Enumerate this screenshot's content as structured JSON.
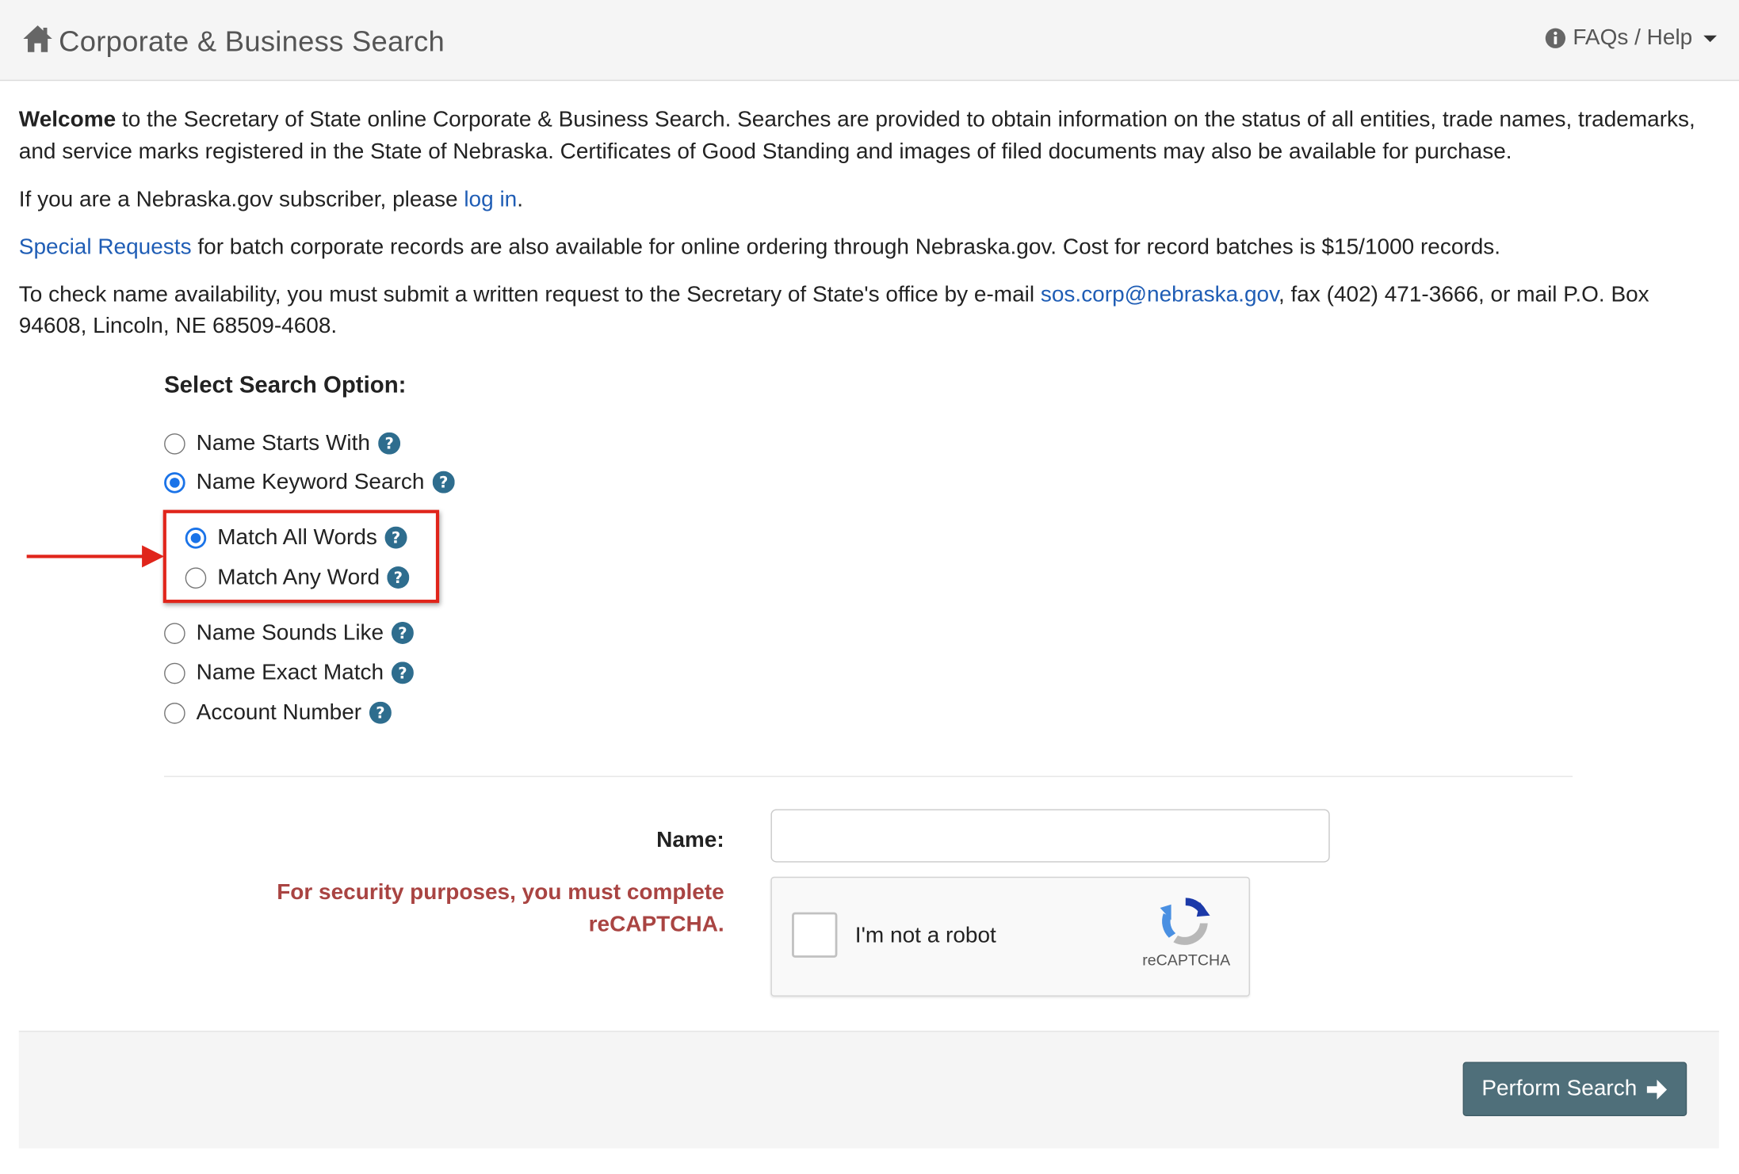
{
  "header": {
    "title": "Corporate & Business Search",
    "faq_label": "FAQs / Help"
  },
  "intro": {
    "p1_bold": "Welcome",
    "p1_rest": " to the Secretary of State online Corporate & Business Search. Searches are provided to obtain information on the status of all entities, trade names, trademarks, and service marks registered in the State of Nebraska. Certificates of Good Standing and images of filed documents may also be available for purchase.",
    "p2_pre": "If you are a Nebraska.gov subscriber, please ",
    "p2_link": "log in",
    "p2_post": ".",
    "p3_link": "Special Requests",
    "p3_rest": " for batch corporate records are also available for online ordering through Nebraska.gov. Cost for record batches is $15/1000 records.",
    "p4_pre": "To check name availability, you must submit a written request to the Secretary of State's office by e-mail ",
    "p4_link": "sos.corp@nebraska.gov",
    "p4_post": ", fax (402) 471-3666, or mail P.O. Box 94608, Lincoln, NE 68509-4608."
  },
  "search_options": {
    "heading": "Select Search Option:",
    "options": [
      {
        "label": "Name Starts With",
        "checked": false
      },
      {
        "label": "Name Keyword Search",
        "checked": true
      },
      {
        "label": "Match All Words",
        "checked": true
      },
      {
        "label": "Match Any Word",
        "checked": false
      },
      {
        "label": "Name Sounds Like",
        "checked": false
      },
      {
        "label": "Name Exact Match",
        "checked": false
      },
      {
        "label": "Account Number",
        "checked": false
      }
    ]
  },
  "form": {
    "name_label": "Name:",
    "name_value": "",
    "security_message": "For security purposes, you must complete reCAPTCHA.",
    "recaptcha_label": "I'm not a robot",
    "recaptcha_brand": "reCAPTCHA",
    "submit_label": "Perform Search"
  },
  "colors": {
    "link": "#1f5db5",
    "radio_checked": "#1a73e8",
    "help_icon": "#2e6d8e",
    "highlight": "#e0251b",
    "error_text": "#a94442",
    "button_bg": "#4f6f7a"
  }
}
